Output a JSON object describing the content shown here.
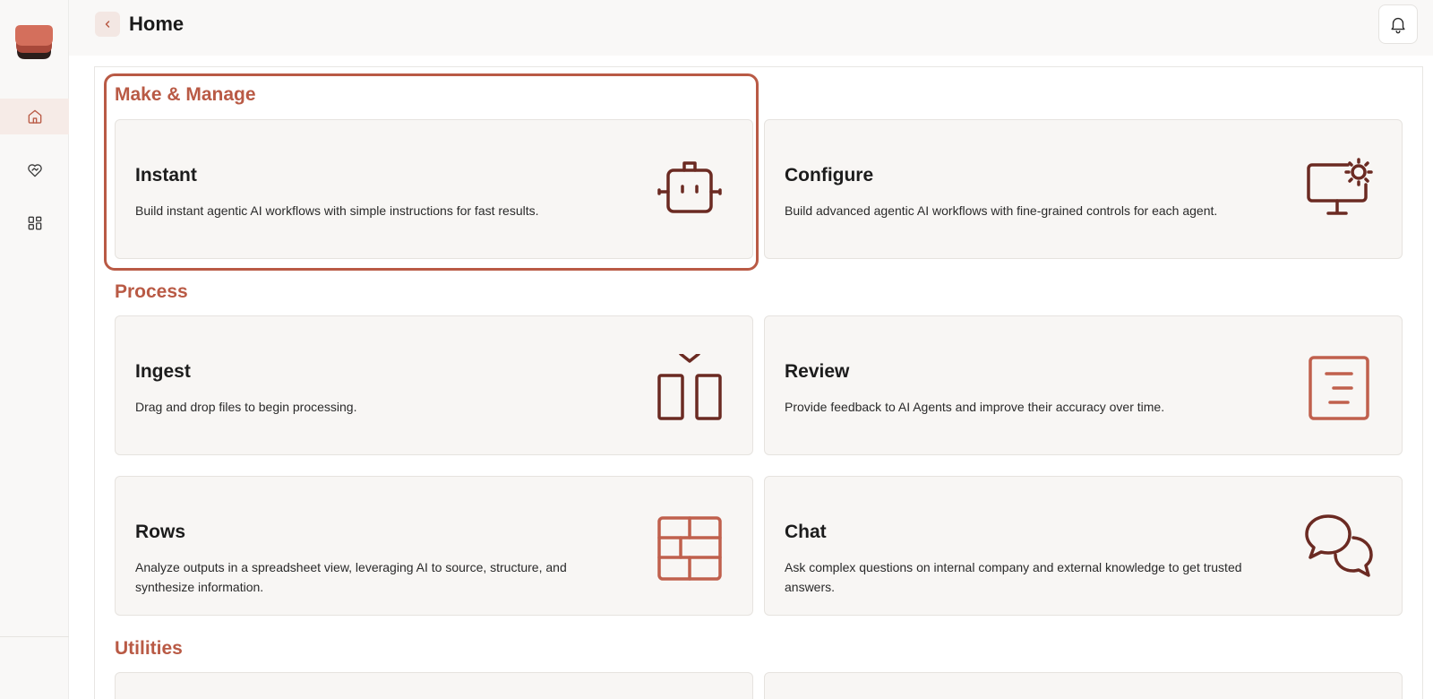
{
  "header": {
    "title": "Home"
  },
  "sidebar": {
    "items": [
      {
        "name": "home",
        "icon": "home-icon",
        "active": true
      },
      {
        "name": "heart-handshake",
        "icon": "heart-handshake-icon",
        "active": false
      },
      {
        "name": "apps",
        "icon": "apps-grid-icon",
        "active": false
      }
    ]
  },
  "sections": {
    "make_manage": {
      "title": "Make & Manage",
      "cards": [
        {
          "title": "Instant",
          "description": "Build instant agentic AI workflows with simple instructions for fast results.",
          "icon": "robot-icon"
        },
        {
          "title": "Configure",
          "description": "Build advanced agentic AI workflows with fine-grained controls for each agent.",
          "icon": "monitor-gear-icon"
        }
      ]
    },
    "process": {
      "title": "Process",
      "cards": [
        {
          "title": "Ingest",
          "description": "Drag and drop files to begin processing.",
          "icon": "ingest-icon"
        },
        {
          "title": "Review",
          "description": "Provide feedback to AI Agents and improve their accuracy over time.",
          "icon": "review-document-icon"
        },
        {
          "title": "Rows",
          "description": "Analyze outputs in a spreadsheet view, leveraging AI to source, structure, and synthesize information.",
          "icon": "table-icon"
        },
        {
          "title": "Chat",
          "description": "Ask complex questions on internal company and external knowledge to get trusted answers.",
          "icon": "chat-bubbles-icon"
        }
      ]
    },
    "utilities": {
      "title": "Utilities"
    }
  },
  "colors": {
    "accent": "#b95a45",
    "icon_dark": "#6b2a22",
    "card_bg": "#f8f6f4"
  }
}
